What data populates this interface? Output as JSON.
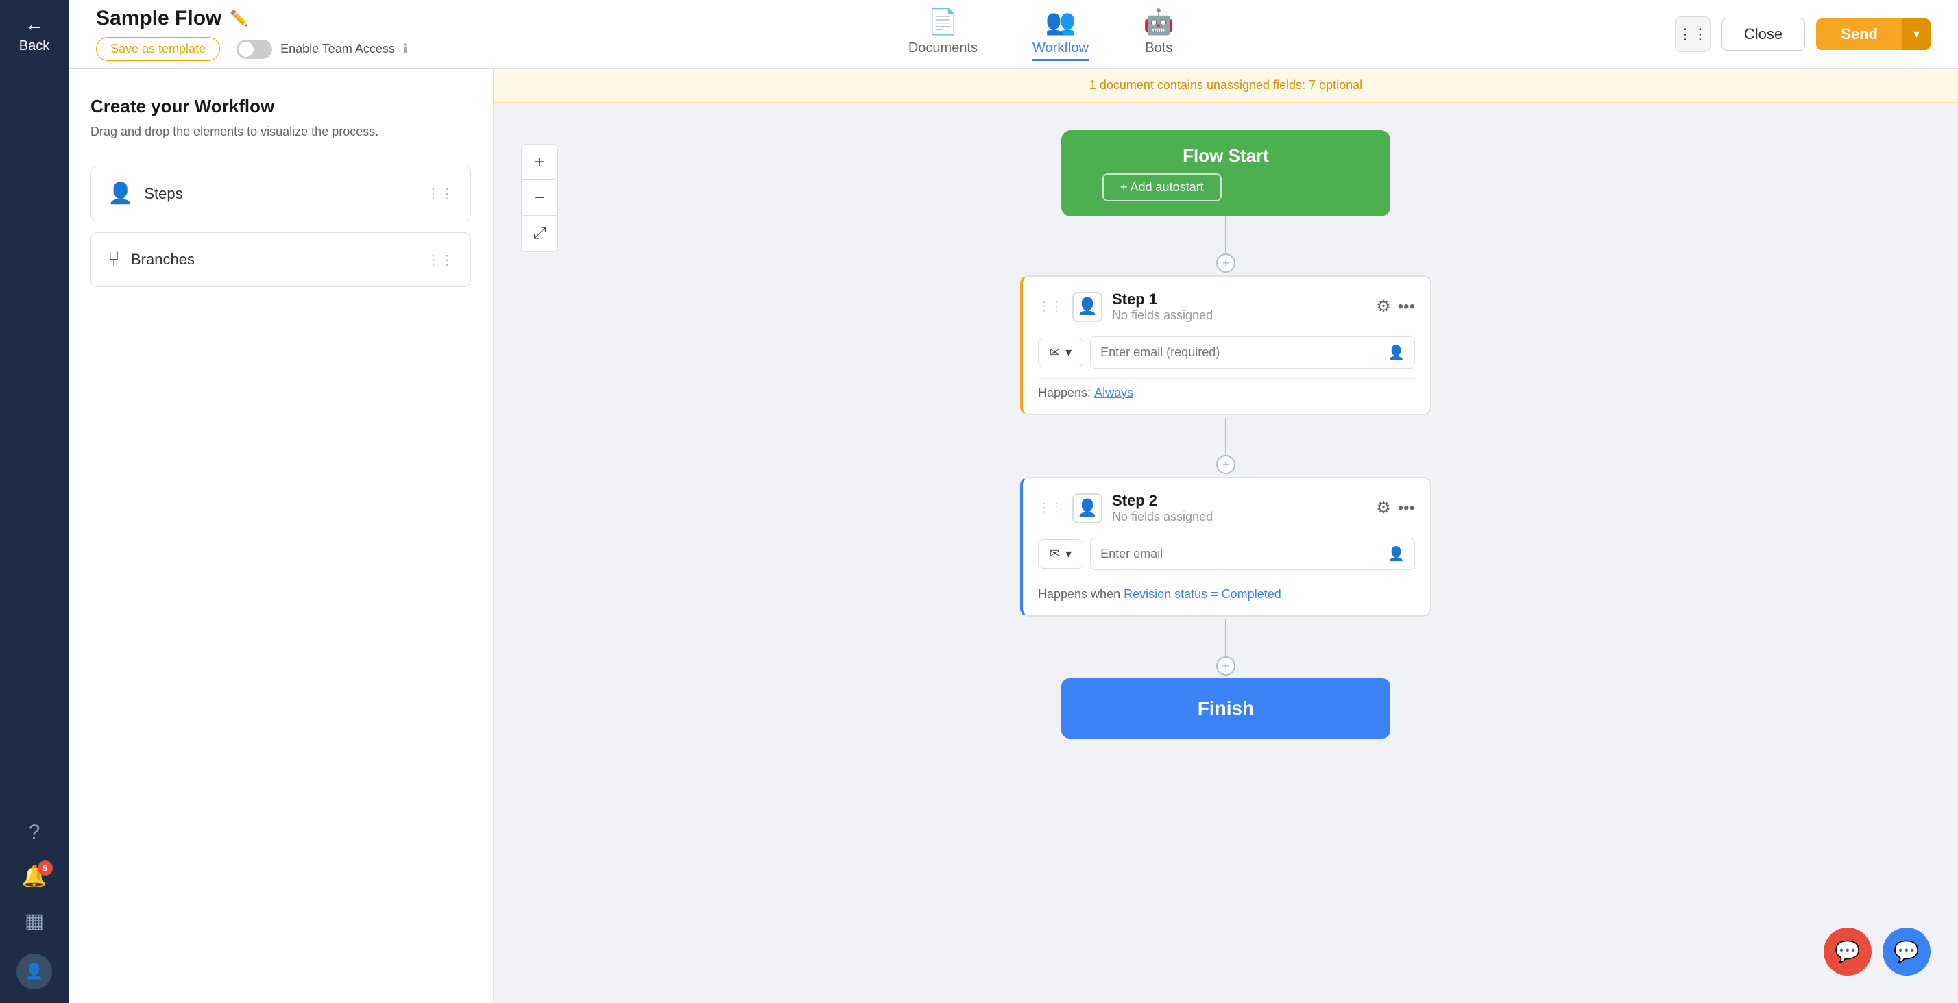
{
  "nav": {
    "back_label": "Back",
    "icons": [
      "?",
      "🔔",
      "▦",
      "👤"
    ],
    "badge_count": "5"
  },
  "header": {
    "flow_title": "Sample Flow",
    "edit_icon": "✏️",
    "save_template_label": "Save as template",
    "enable_access_label": "Enable Team Access",
    "tabs": [
      {
        "id": "documents",
        "label": "Documents",
        "icon": "📄"
      },
      {
        "id": "workflow",
        "label": "Workflow",
        "icon": "👥",
        "active": true
      },
      {
        "id": "bots",
        "label": "Bots",
        "icon": "🤖"
      }
    ],
    "close_label": "Close",
    "send_label": "Send",
    "send_dropdown_label": "▾"
  },
  "sidebar": {
    "title": "Create your Workflow",
    "description": "Drag and drop the elements to visualize the process.",
    "items": [
      {
        "id": "steps",
        "label": "Steps",
        "icon": "👤"
      },
      {
        "id": "branches",
        "label": "Branches",
        "icon": "⑂"
      }
    ]
  },
  "banner": {
    "text": "1 document contains unassigned fields: 7 optional"
  },
  "canvas": {
    "zoom_in": "+",
    "zoom_out": "−",
    "zoom_fit": "⤢",
    "flow_start_label": "Flow Start",
    "add_autostart_label": "+ Add autostart",
    "connector_add": "+",
    "steps": [
      {
        "id": "step1",
        "name": "Step 1",
        "fields_label": "No fields assigned",
        "email_icon": "✉",
        "email_placeholder": "Enter email (required)",
        "happens_label": "Happens:",
        "happens_value": "Always",
        "border_color": "#f5a623"
      },
      {
        "id": "step2",
        "name": "Step 2",
        "fields_label": "No fields assigned",
        "email_icon": "✉",
        "email_placeholder": "Enter email",
        "happens_label": "Happens when",
        "happens_value": "Revision status = Completed",
        "border_color": "#3b82f6"
      }
    ],
    "finish_label": "Finish"
  }
}
